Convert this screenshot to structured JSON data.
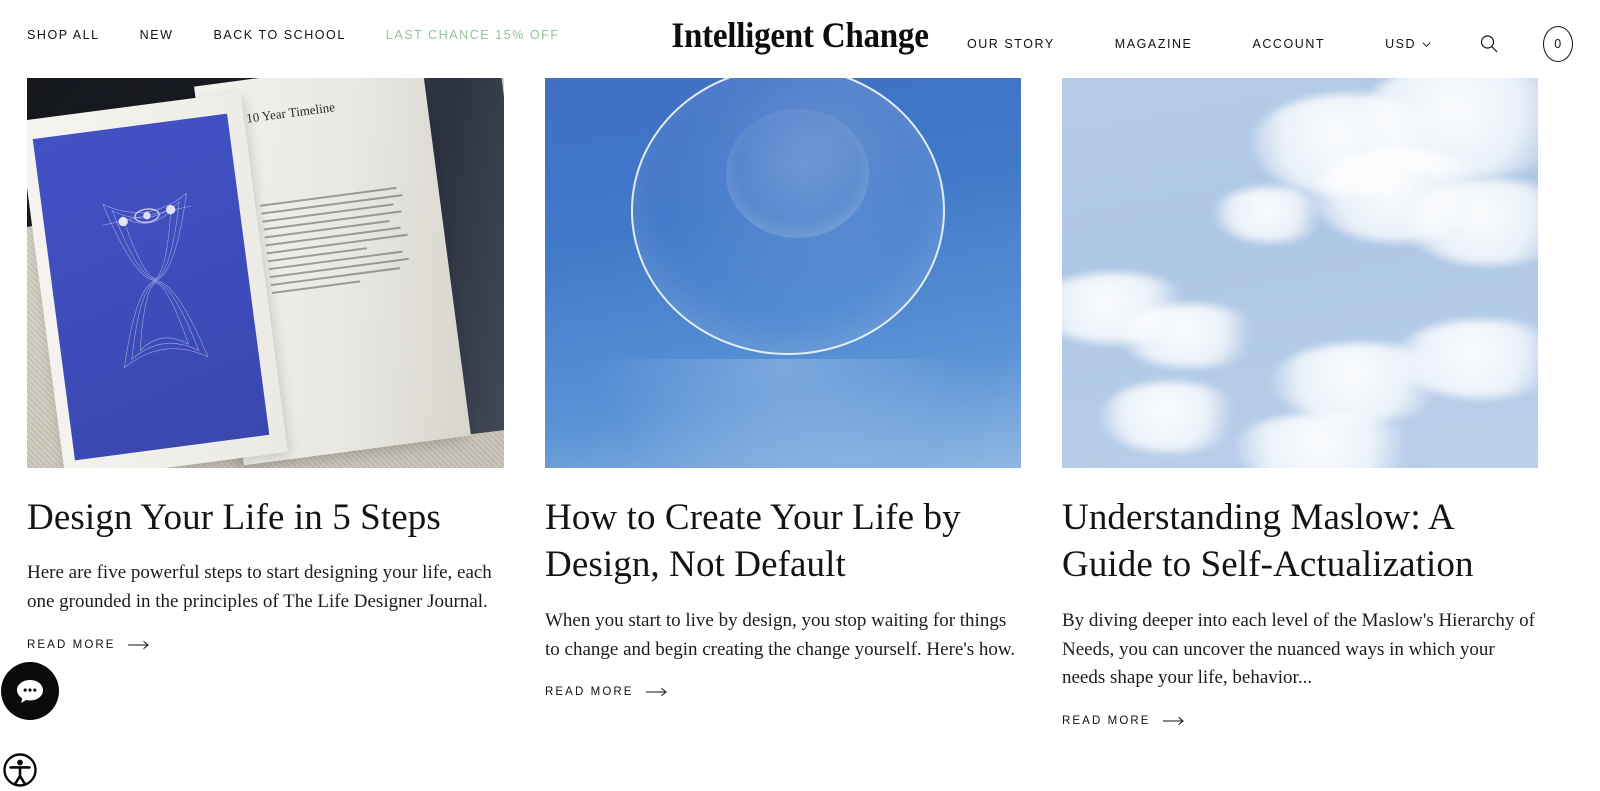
{
  "header": {
    "logo": "Intelligent Change",
    "nav_left": [
      {
        "label": "SHOP ALL",
        "name": "nav-shop-all"
      },
      {
        "label": "NEW",
        "name": "nav-new"
      },
      {
        "label": "BACK TO SCHOOL",
        "name": "nav-back-to-school"
      },
      {
        "label": "LAST CHANCE 15% OFF",
        "name": "nav-last-chance",
        "accent": "#93bf98"
      }
    ],
    "nav_right": [
      {
        "label": "OUR STORY",
        "name": "nav-our-story"
      },
      {
        "label": "MAGAZINE",
        "name": "nav-magazine"
      },
      {
        "label": "ACCOUNT",
        "name": "nav-account"
      }
    ],
    "currency": "USD",
    "currency_icon": "chevron-down-icon",
    "search_icon": "search-icon",
    "cart_count": "0"
  },
  "articles": [
    {
      "title": "Design Your Life in 5 Steps",
      "excerpt": "Here are five powerful steps to start designing your life, each one grounded in the principles of The Life Designer Journal.",
      "read_more": "READ MORE",
      "image_alt": "open-book-life-designer-journal",
      "image_headline": "10 Year Timeline"
    },
    {
      "title": "How to Create Your Life by Design, Not Default",
      "excerpt": "When you start to live by design, you stop waiting for things to change and begin creating the change yourself. Here's how.",
      "read_more": "READ MORE",
      "image_alt": "glass-sphere-on-blue-background"
    },
    {
      "title": "Understanding Maslow: A Guide to Self-Actualization",
      "excerpt": "By diving deeper into each level of the Maslow's Hierarchy of Needs, you can uncover the nuanced ways in which your needs shape your life, behavior...",
      "read_more": "READ MORE",
      "image_alt": "blue-sky-with-white-clouds"
    }
  ],
  "widgets": {
    "chat_icon": "chat-bubble-icon",
    "accessibility_icon": "accessibility-icon"
  },
  "colors": {
    "text": "#111111",
    "promo_green": "#93bf98",
    "background": "#ffffff"
  }
}
